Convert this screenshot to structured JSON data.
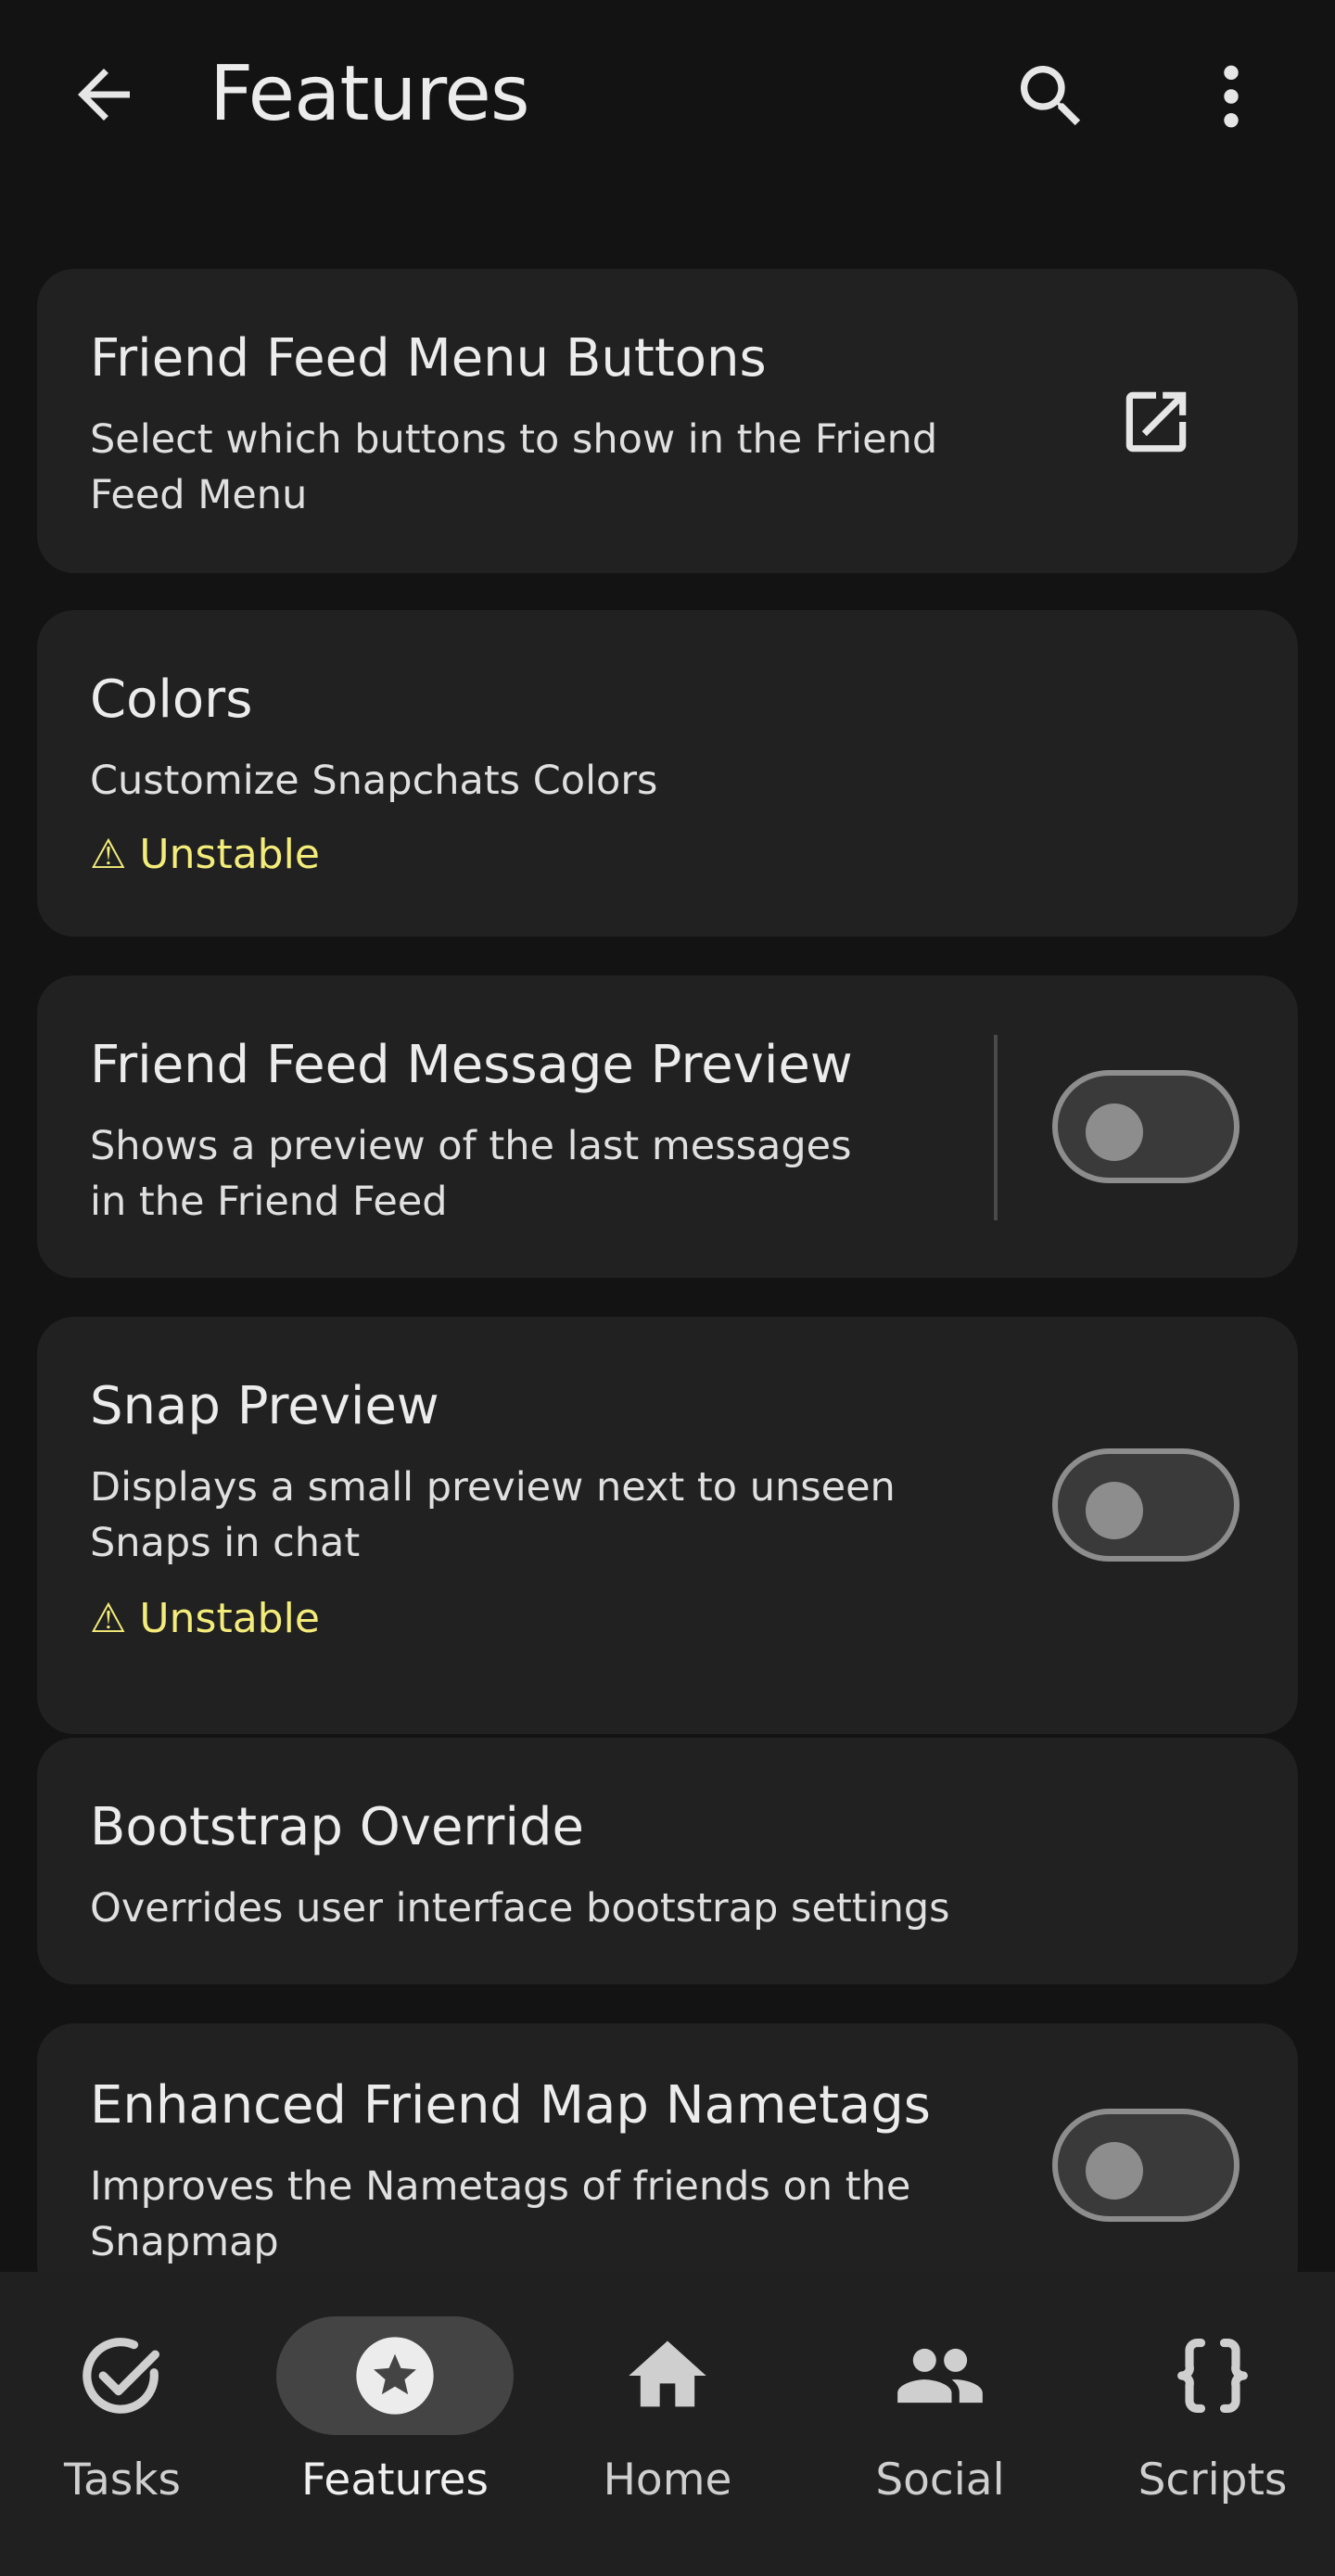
{
  "header": {
    "title": "Features",
    "back_icon": "arrow-back-icon",
    "search_icon": "search-icon",
    "more_icon": "more-vert-icon"
  },
  "features": [
    {
      "title": "Friend Feed Menu Buttons",
      "desc_lines": [
        "Select which buttons to show in the Friend",
        "Feed Menu"
      ],
      "control": "open-external"
    },
    {
      "title": "Colors",
      "desc_lines": [
        "Customize Snapchats Colors"
      ],
      "warning": "⚠ Unstable",
      "control": "none"
    },
    {
      "title": "Friend Feed Message Preview",
      "desc_lines": [
        "Shows a preview of the last messages",
        "in the Friend Feed"
      ],
      "control": "toggle",
      "enabled": false
    },
    {
      "title": "Snap Preview",
      "desc_lines": [
        "Displays a small preview next to unseen",
        "Snaps in chat"
      ],
      "warning": "⚠ Unstable",
      "control": "toggle",
      "enabled": false
    },
    {
      "title": "Bootstrap Override",
      "desc_lines": [
        "Overrides user interface bootstrap settings"
      ],
      "control": "none"
    },
    {
      "title": "Enhanced Friend Map Nametags",
      "desc_lines": [
        "Improves the Nametags of friends on the",
        "Snapmap"
      ],
      "control": "toggle",
      "enabled": false
    }
  ],
  "nav": [
    {
      "label": "Tasks",
      "icon": "task-check-icon",
      "active": false
    },
    {
      "label": "Features",
      "icon": "star-icon",
      "active": true
    },
    {
      "label": "Home",
      "icon": "home-icon",
      "active": false
    },
    {
      "label": "Social",
      "icon": "people-icon",
      "active": false
    },
    {
      "label": "Scripts",
      "icon": "braces-icon",
      "active": false
    }
  ],
  "colors": {
    "background": "#131313",
    "card": "#212121",
    "warning": "#f4ec7a",
    "navbar": "#202020",
    "active_pill": "#444444"
  }
}
